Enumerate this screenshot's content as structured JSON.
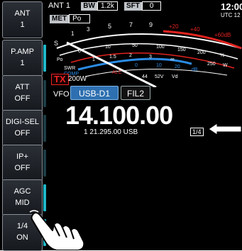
{
  "sidebar": {
    "buttons": [
      {
        "title": "ANT",
        "value": "1"
      },
      {
        "title": "P.AMP",
        "value": "1"
      },
      {
        "title": "ATT",
        "value": "OFF"
      },
      {
        "title": "DIGI-SEL",
        "value": "OFF"
      },
      {
        "title": "IP+",
        "value": "OFF"
      },
      {
        "title": "AGC",
        "value": "MID"
      },
      {
        "title": "1/4",
        "value": "ON"
      }
    ]
  },
  "header": {
    "ant": "ANT 1",
    "bw_tag": "BW",
    "bw_value": "1.2k",
    "sft_tag": "SFT",
    "sft_value": "0",
    "met_tag": "MET",
    "met_value": "Po"
  },
  "clock": {
    "time": "12:00",
    "zone": "UTC 12"
  },
  "meter": {
    "s_scale": [
      "S",
      "1",
      "3",
      "5",
      "7",
      "9",
      "+20",
      "+40",
      "+60dB"
    ],
    "po_scale": [
      "Po",
      "0",
      "10",
      "50",
      "100",
      "150",
      "200",
      "%"
    ],
    "swr_scale": [
      "SWR",
      "1",
      "1.5",
      "2",
      "3",
      "∞"
    ],
    "comp_scale": [
      "COMP",
      "0",
      "10",
      "20",
      "dB"
    ],
    "alc_label": "ALC",
    "vd_scale": [
      "10",
      "15",
      "20",
      "25",
      "250",
      "W"
    ],
    "vd_label": "Vd",
    "extra": [
      "44",
      "52V"
    ],
    "colors": {
      "red": "#e0231f",
      "blue": "#2b8ce6"
    }
  },
  "tx": {
    "label": "TX",
    "power": "200W"
  },
  "vfo": {
    "label": "VFO",
    "mode": "USB-D1",
    "filter": "FIL2"
  },
  "frequency": {
    "main": "14.100.00",
    "sub": "1  21.295.00  USB",
    "quarter_indicator": "1/4"
  }
}
